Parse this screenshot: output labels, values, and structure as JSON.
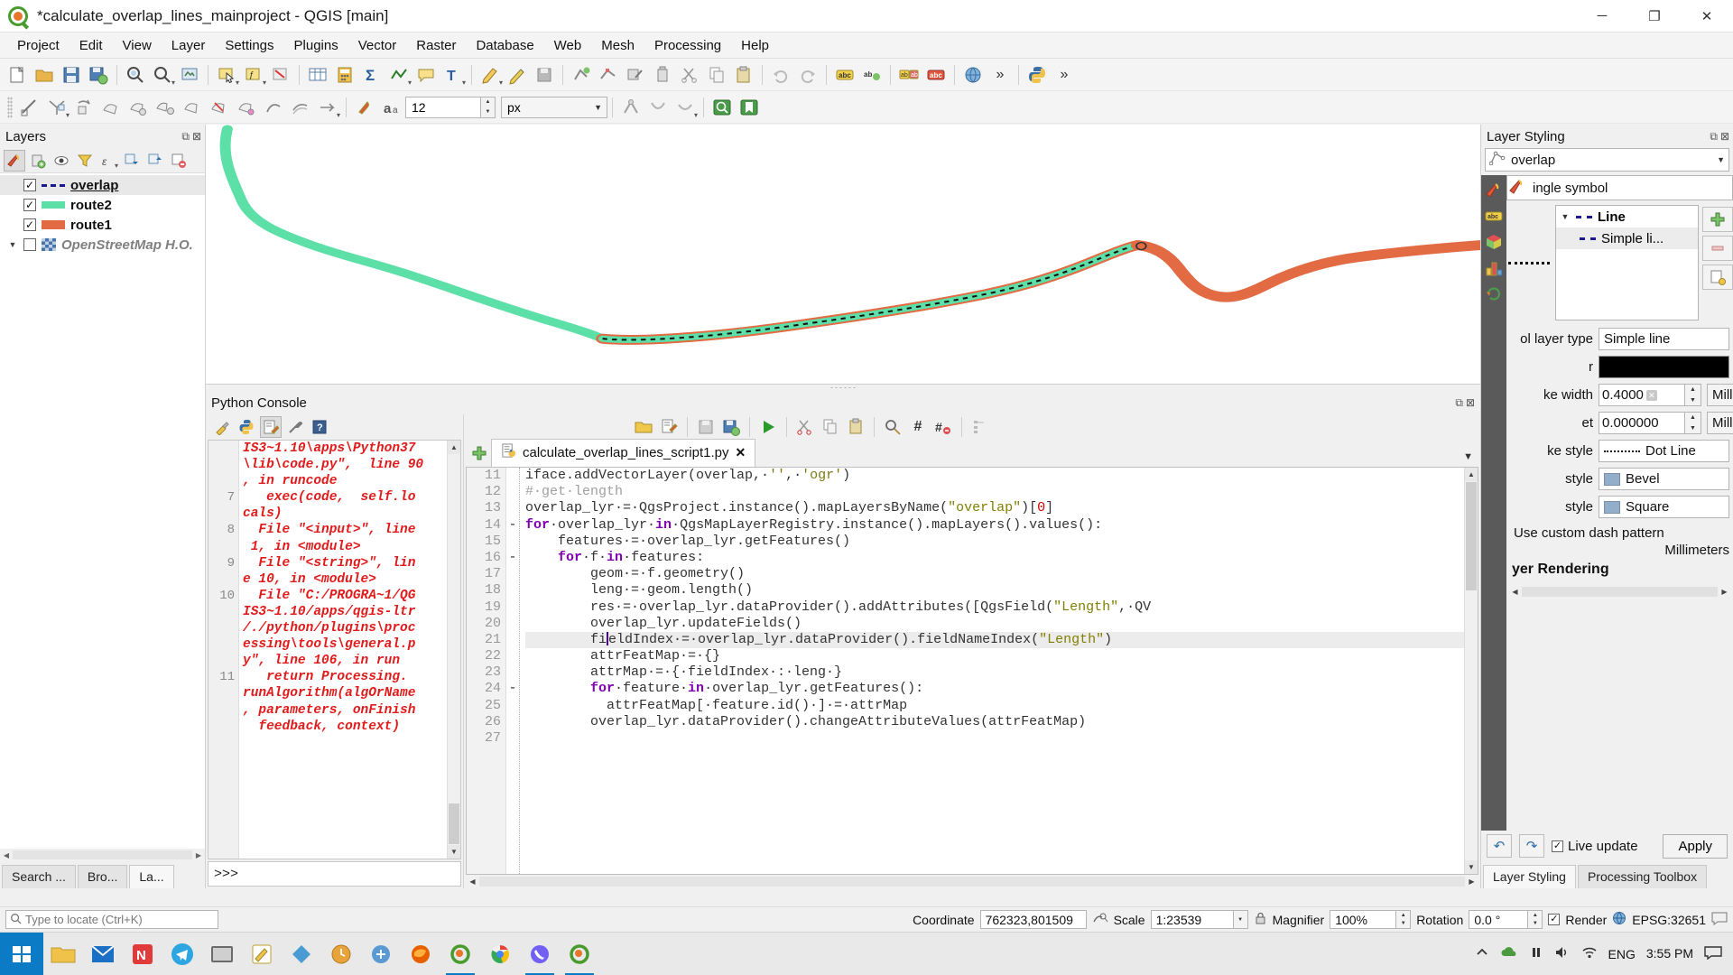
{
  "window": {
    "title": "*calculate_overlap_lines_mainproject - QGIS [main]",
    "minimize_label": "─",
    "maximize_label": "❐",
    "close_label": "✕"
  },
  "menubar": {
    "items": [
      "Project",
      "Edit",
      "View",
      "Layer",
      "Settings",
      "Plugins",
      "Vector",
      "Raster",
      "Database",
      "Web",
      "Mesh",
      "Processing",
      "Help"
    ]
  },
  "toolbar2": {
    "size_value": "12",
    "unit_value": "px"
  },
  "layers_panel": {
    "title": "Layers",
    "items": [
      {
        "checked": "✓",
        "name": "overlap",
        "symbol": "dash",
        "selected": true,
        "bold": true,
        "underline": true
      },
      {
        "checked": "✓",
        "name": "route2",
        "symbol": "line",
        "color": "#5ce0a8",
        "selected": false
      },
      {
        "checked": "✓",
        "name": "route1",
        "symbol": "line",
        "color": "#e26b43",
        "selected": false
      },
      {
        "checked": "",
        "name": "OpenStreetMap H.O.",
        "symbol": "raster",
        "selected": false,
        "grey": true
      }
    ],
    "tabs": [
      {
        "label": "Search ...",
        "active": false
      },
      {
        "label": "Bro...",
        "active": false
      },
      {
        "label": "La...",
        "active": true
      }
    ]
  },
  "python_console": {
    "title": "Python Console",
    "prompt": ">>>",
    "output_lines": [
      {
        "num": "",
        "text": "IS3~1.10\\apps\\Python37"
      },
      {
        "num": "",
        "text": "\\lib\\code.py\",  line 90"
      },
      {
        "num": "",
        "text": ", in runcode"
      },
      {
        "num": "7",
        "text": "   exec(code,  self.lo"
      },
      {
        "num": "",
        "text": "cals)"
      },
      {
        "num": "8",
        "text": "  File \"<input>\", line"
      },
      {
        "num": "",
        "text": " 1, in <module>"
      },
      {
        "num": "9",
        "text": "  File \"<string>\", lin"
      },
      {
        "num": "",
        "text": "e 10, in <module>"
      },
      {
        "num": "10",
        "text": "  File \"C:/PROGRA~1/QG"
      },
      {
        "num": "",
        "text": "IS3~1.10/apps/qgis-ltr"
      },
      {
        "num": "",
        "text": "/./python/plugins\\proc"
      },
      {
        "num": "",
        "text": "essing\\tools\\general.p"
      },
      {
        "num": "",
        "text": "y\", line 106, in run"
      },
      {
        "num": "11",
        "text": "   return Processing."
      },
      {
        "num": "",
        "text": "runAlgorithm(algOrName"
      },
      {
        "num": "",
        "text": ", parameters, onFinish"
      },
      {
        "num": "",
        "text": "  feedback, context)"
      }
    ]
  },
  "editor": {
    "tab_name": "calculate_overlap_lines_script1.py",
    "tab_close": "✕",
    "lines": [
      {
        "num": "11",
        "fold": "",
        "code": "iface.addVectorLayer(overlap,·'',·'ogr')"
      },
      {
        "num": "12",
        "fold": "",
        "code": "#·get·length"
      },
      {
        "num": "13",
        "fold": "",
        "code": "overlap_lyr·=·QgsProject.instance().mapLayersByName(\"overlap\")[0]"
      },
      {
        "num": "14",
        "fold": "-",
        "code": "for·overlap_lyr·in·QgsMapLayerRegistry.instance().mapLayers().values():"
      },
      {
        "num": "15",
        "fold": "",
        "code": "    features·=·overlap_lyr.getFeatures()"
      },
      {
        "num": "16",
        "fold": "-",
        "code": "    for·f·in·features:"
      },
      {
        "num": "17",
        "fold": "",
        "code": "        geom·=·f.geometry()"
      },
      {
        "num": "18",
        "fold": "",
        "code": "        leng·=·geom.length()"
      },
      {
        "num": "19",
        "fold": "",
        "code": "        res·=·overlap_lyr.dataProvider().addAttributes([QgsField(\"Length\",·QV"
      },
      {
        "num": "20",
        "fold": "",
        "code": "        overlap_lyr.updateFields()"
      },
      {
        "num": "21",
        "fold": "",
        "code": "        fieldIndex·=·overlap_lyr.dataProvider().fieldNameIndex(\"Length\")"
      },
      {
        "num": "22",
        "fold": "",
        "code": "        attrFeatMap·=·{}"
      },
      {
        "num": "23",
        "fold": "",
        "code": "        attrMap·=·{·fieldIndex·:·leng·}"
      },
      {
        "num": "24",
        "fold": "-",
        "code": "        for·feature·in·overlap_lyr.getFeatures():"
      },
      {
        "num": "25",
        "fold": "",
        "code": "          attrFeatMap[·feature.id()·]·=·attrMap"
      },
      {
        "num": "26",
        "fold": "",
        "code": "        overlap_lyr.dataProvider().changeAttributeValues(attrFeatMap)"
      },
      {
        "num": "27",
        "fold": "",
        "code": ""
      }
    ]
  },
  "layer_styling": {
    "title": "Layer Styling",
    "layer_name": "overlap",
    "renderer": "ingle symbol",
    "tree": {
      "root_label": "Line",
      "child_label": "Simple li..."
    },
    "fields": {
      "symbol_layer_type_label": "ol layer type",
      "symbol_layer_type_value": "Simple line",
      "color_label": "r",
      "color_value": "#000000",
      "stroke_width_label": "ke width",
      "stroke_width_value": "0.4000",
      "stroke_width_unit": "Millimeters",
      "offset_label": "et",
      "offset_value": "0.000000",
      "offset_unit": "Millimeters",
      "stroke_style_label": "ke style",
      "stroke_style_value": "Dot Line",
      "join_style_label": "style",
      "join_style_value": "Bevel",
      "cap_style_label": "style",
      "cap_style_value": "Square",
      "custom_dash_label": "Use custom dash pattern",
      "custom_dash_unit": "Millimeters"
    },
    "rendering_header": "yer Rendering",
    "live_update_label": "Live update",
    "live_update_checked": "✓",
    "apply_label": "Apply",
    "undo_label": "↶",
    "redo_label": "↷",
    "tabs": [
      {
        "label": "Layer Styling",
        "active": true
      },
      {
        "label": "Processing Toolbox",
        "active": false
      }
    ]
  },
  "statusbar": {
    "locator_placeholder": "Type to locate (Ctrl+K)",
    "coordinate_label": "Coordinate",
    "coordinate_value": "762323,801509",
    "scale_label": "Scale",
    "scale_value": "1:23539",
    "magnifier_label": "Magnifier",
    "magnifier_value": "100%",
    "rotation_label": "Rotation",
    "rotation_value": "0.0 °",
    "render_label": "Render",
    "render_checked": "✓",
    "crs_value": "EPSG:32651"
  },
  "taskbar": {
    "language": "ENG",
    "time": "3:55 PM"
  }
}
